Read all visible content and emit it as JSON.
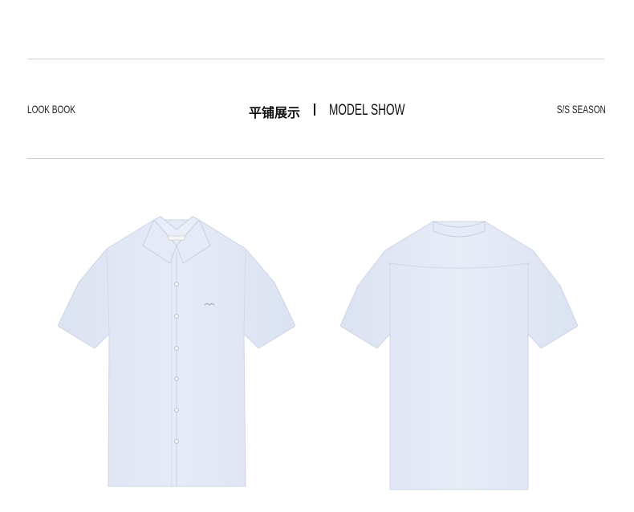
{
  "header": {
    "left_label": "LOOK BOOK",
    "title_cn": "平铺展示",
    "title_en": "MODEL SHOW",
    "right_label": "S/S SEASON"
  },
  "colors": {
    "shirt": "#e3e9f5",
    "shirt_shadow": "#d2daeb",
    "rule": "#cfcfcf"
  },
  "images": {
    "front": "shirt-front-icon",
    "back": "shirt-back-icon"
  }
}
